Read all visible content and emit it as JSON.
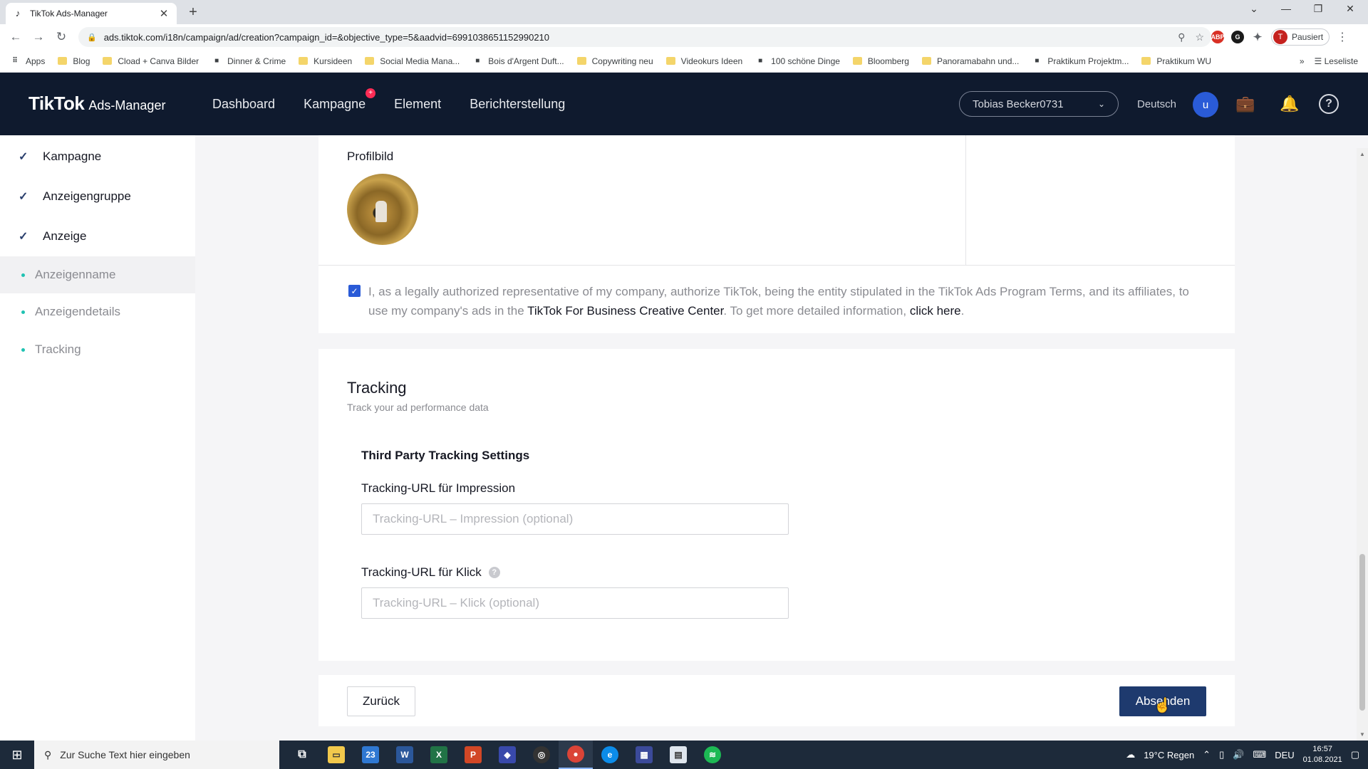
{
  "browser": {
    "tab_title": "TikTok Ads-Manager",
    "url": "ads.tiktok.com/i18n/campaign/ad/creation?campaign_id=&objective_type=5&aadvid=6991038651152990210",
    "profile_status": "Pausiert",
    "profile_initial": "T",
    "bookmarks": [
      {
        "label": "Apps",
        "icon": "apps-grid-icon"
      },
      {
        "label": "Blog",
        "icon": "folder-icon"
      },
      {
        "label": "Cload + Canva Bilder",
        "icon": "folder-icon"
      },
      {
        "label": "Dinner & Crime",
        "icon": "site-icon"
      },
      {
        "label": "Kursideen",
        "icon": "folder-icon"
      },
      {
        "label": "Social Media Mana...",
        "icon": "folder-icon"
      },
      {
        "label": "Bois d'Argent Duft...",
        "icon": "site-icon"
      },
      {
        "label": "Copywriting neu",
        "icon": "folder-icon"
      },
      {
        "label": "Videokurs Ideen",
        "icon": "folder-icon"
      },
      {
        "label": "100 schöne Dinge",
        "icon": "site-icon"
      },
      {
        "label": "Bloomberg",
        "icon": "folder-icon"
      },
      {
        "label": "Panoramabahn und...",
        "icon": "folder-icon"
      },
      {
        "label": "Praktikum Projektm...",
        "icon": "site-icon"
      },
      {
        "label": "Praktikum WU",
        "icon": "folder-icon"
      }
    ],
    "reading_list": "Leseliste"
  },
  "header": {
    "brand": "TikTok",
    "brand_sub": "Ads-Manager",
    "nav": [
      "Dashboard",
      "Kampagne",
      "Element",
      "Berichterstellung"
    ],
    "account": "Tobias Becker0731",
    "language": "Deutsch",
    "user_initial": "u"
  },
  "sidebar": {
    "steps": [
      "Kampagne",
      "Anzeigengruppe",
      "Anzeige"
    ],
    "substeps": [
      "Anzeigenname",
      "Anzeigendetails",
      "Tracking"
    ],
    "active_substep": "Anzeigenname"
  },
  "profile": {
    "label": "Profilbild"
  },
  "consent": {
    "checked": true,
    "text_before": "I, as a legally authorized representative of my company, authorize TikTok, being the entity stipulated in the TikTok Ads Program Terms, and its affiliates, to use my company's ads in the ",
    "link1": "TikTok For Business Creative Center",
    "text_middle": ". To get more detailed information, ",
    "link2": "click here",
    "text_after": "."
  },
  "tracking": {
    "title": "Tracking",
    "subtitle": "Track your ad performance data",
    "section_title": "Third Party Tracking Settings",
    "impression_label": "Tracking-URL für Impression",
    "impression_placeholder": "Tracking-URL – Impression (optional)",
    "click_label": "Tracking-URL für Klick",
    "click_placeholder": "Tracking-URL – Klick (optional)"
  },
  "footer": {
    "back": "Zurück",
    "submit": "Absenden"
  },
  "taskbar": {
    "search_placeholder": "Zur Suche Text hier eingeben",
    "weather": "19°C  Regen",
    "lang": "DEU",
    "time": "16:57",
    "date": "01.08.2021",
    "mail_badge": "23"
  },
  "colors": {
    "header_bg": "#0f1a2e",
    "primary_button": "#1e3a6e",
    "accent_red": "#fe2c55",
    "checkbox": "#2a5bd7"
  }
}
